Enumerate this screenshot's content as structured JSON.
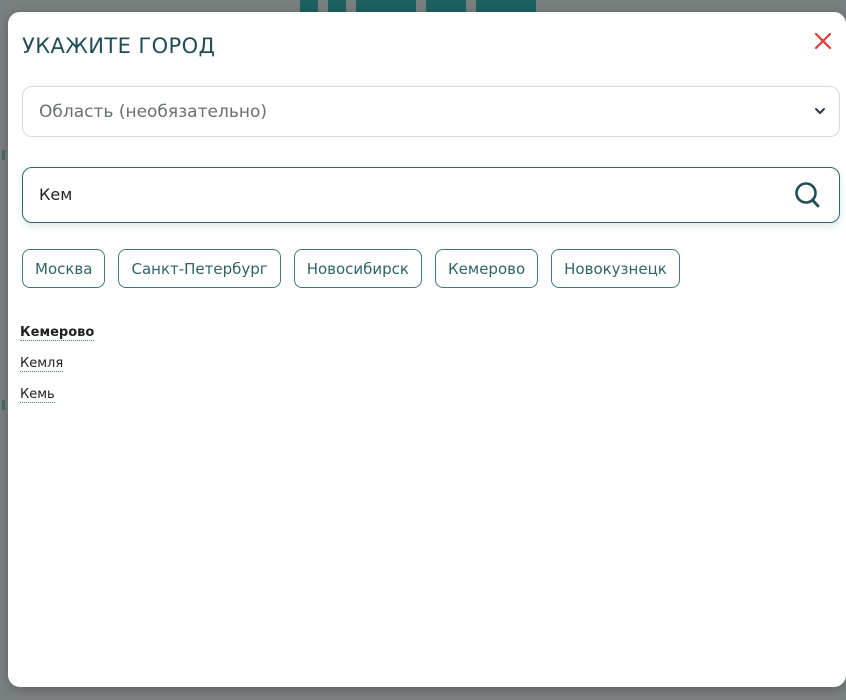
{
  "modal": {
    "title": "УКАЖИТЕ ГОРОД",
    "close_icon": "close-icon",
    "close_color": "#e53935"
  },
  "region_select": {
    "placeholder": "Область (необязательно)",
    "icon": "chevron-down-icon"
  },
  "search": {
    "value": "Кем",
    "icon": "search-icon"
  },
  "quick_cities": [
    {
      "label": "Москва"
    },
    {
      "label": "Санкт-Петербург"
    },
    {
      "label": "Новосибирск"
    },
    {
      "label": "Кемерово"
    },
    {
      "label": "Новокузнецк"
    }
  ],
  "results": [
    {
      "label": "Кемерово",
      "active": true
    },
    {
      "label": "Кемля",
      "active": false
    },
    {
      "label": "Кемь",
      "active": false
    }
  ],
  "colors": {
    "accent": "#2c6a6d",
    "title": "#1f4f55",
    "backdrop": "#7a7f7f"
  }
}
